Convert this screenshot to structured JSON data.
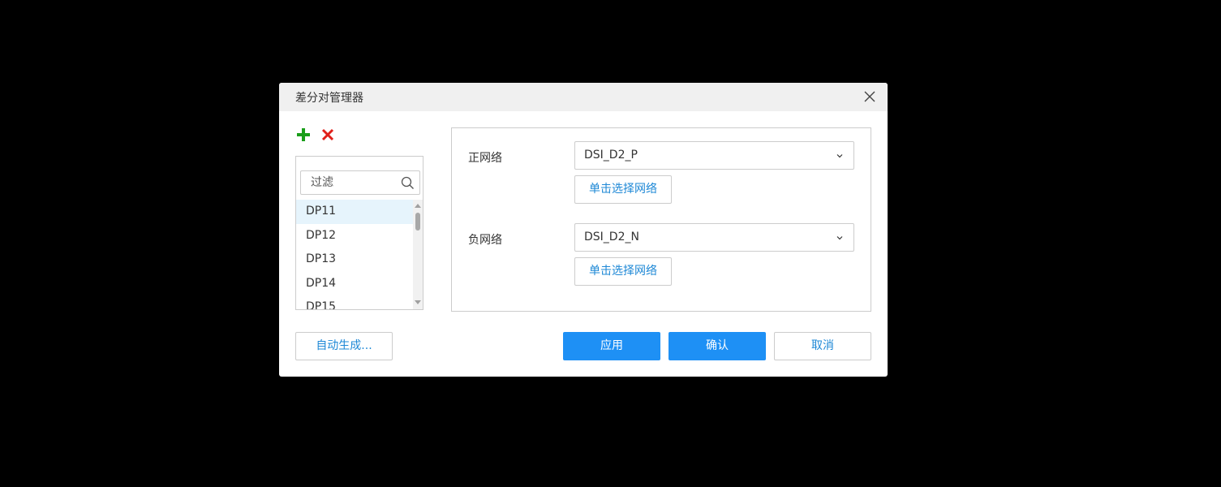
{
  "dialog": {
    "title": "差分对管理器",
    "close_icon": "close-icon"
  },
  "toolbar": {
    "add_icon": "plus-icon",
    "add_color": "#1a9e1a",
    "delete_icon": "x-icon",
    "delete_color": "#e0201a"
  },
  "list": {
    "filter_placeholder": "过滤",
    "filter_value": "",
    "selected_index": 0,
    "items": [
      "DP11",
      "DP12",
      "DP13",
      "DP14",
      "DP15"
    ]
  },
  "settings": {
    "positive_label": "正网络",
    "positive_value": "DSI_D2_P",
    "negative_label": "负网络",
    "negative_value": "DSI_D2_N",
    "pick_label": "单击选择网络"
  },
  "footer": {
    "auto_generate_label": "自动生成...",
    "apply_label": "应用",
    "confirm_label": "确认",
    "cancel_label": "取消"
  },
  "colors": {
    "primary": "#1e90f5",
    "link": "#1e88d6",
    "selected_row": "#e6f4fc",
    "titlebar": "#f0f0f0"
  }
}
